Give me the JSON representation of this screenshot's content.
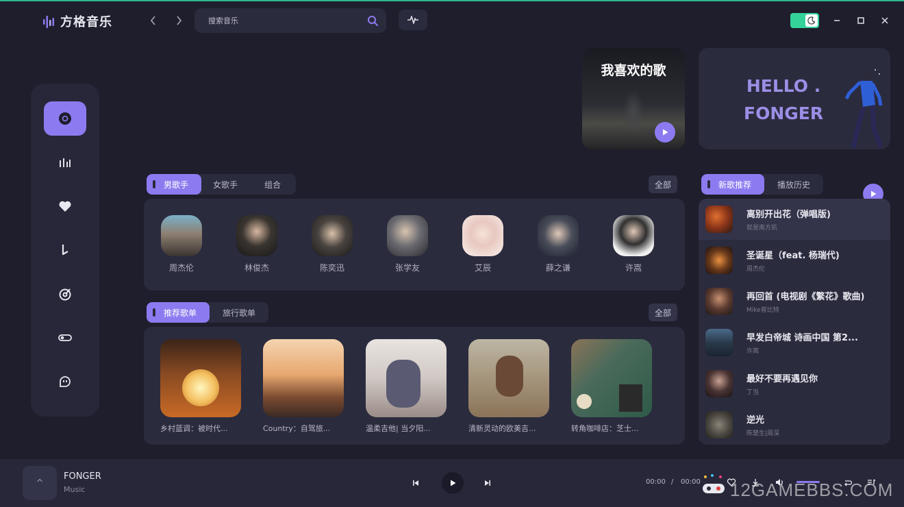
{
  "app": {
    "name": "方格音乐"
  },
  "search": {
    "placeholder": "搜索音乐"
  },
  "banner": {
    "favorites_title": "我喜欢的歌",
    "hello_line1": "HELLO .",
    "hello_line2": "FONGER"
  },
  "artist_section": {
    "tabs": [
      {
        "label": "男歌手",
        "active": true
      },
      {
        "label": "女歌手",
        "active": false
      },
      {
        "label": "组合",
        "active": false
      }
    ],
    "all_label": "全部",
    "artists": [
      {
        "name": "周杰伦"
      },
      {
        "name": "林俊杰"
      },
      {
        "name": "陈奕迅"
      },
      {
        "name": "张学友"
      },
      {
        "name": "艾辰"
      },
      {
        "name": "薛之谦"
      },
      {
        "name": "许嵩"
      }
    ]
  },
  "playlist_section": {
    "tabs": [
      {
        "label": "推荐歌单",
        "active": true
      },
      {
        "label": "旅行歌单",
        "active": false
      }
    ],
    "all_label": "全部",
    "playlists": [
      {
        "name": "乡村蓝调：被时代..."
      },
      {
        "name": "Country：自驾旅..."
      },
      {
        "name": "温柔吉他| 当夕阳..."
      },
      {
        "name": "清新灵动的欧美吉..."
      },
      {
        "name": "转角咖啡店：芝士..."
      }
    ]
  },
  "song_section": {
    "tabs": [
      {
        "label": "新歌推荐",
        "active": true
      },
      {
        "label": "播放历史",
        "active": false
      }
    ],
    "songs": [
      {
        "title": "离别开出花（弹唱版)",
        "artist": "就是南方凯"
      },
      {
        "title": "圣诞星（feat. 杨瑞代)",
        "artist": "周杰伦"
      },
      {
        "title": "再回首 (电视剧《繁花》歌曲)",
        "artist": "Mike曾比特"
      },
      {
        "title": "早发白帝城 诗画中国 第2...",
        "artist": "许嵩"
      },
      {
        "title": "最好不要再遇见你",
        "artist": "丁当"
      },
      {
        "title": "逆光",
        "artist": "陈楚生|周深"
      }
    ]
  },
  "player": {
    "cover_glyph": "^",
    "title": "FONGER",
    "subtitle": "Music",
    "current_time": "00:00",
    "separator": "/",
    "total_time": "00:00"
  },
  "watermark": {
    "text": "12GAMEBBS.COM"
  },
  "colors": {
    "accent": "#8c7bf0",
    "background": "#1e1e2d",
    "panel": "#2b2b3e",
    "toggle": "#34d399"
  }
}
